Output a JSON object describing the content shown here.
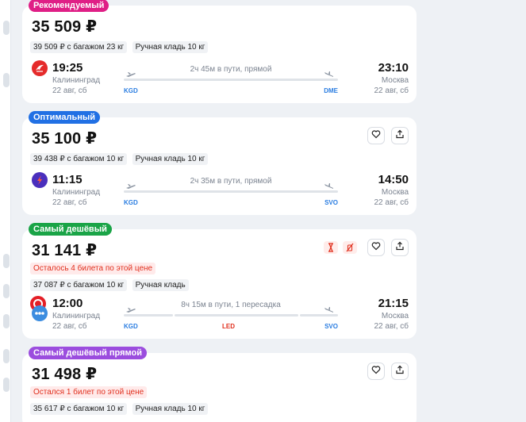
{
  "colors": {
    "recommended": "#df1f86",
    "optimal": "#2170e4",
    "cheapest": "#1aa447",
    "cheapest_direct": "#9b4dde",
    "iata_code": "#2a7de1",
    "transfer_code": "#e0301e",
    "warning_text": "#e0301e"
  },
  "icons": [
    "heart-icon",
    "share-icon",
    "plane-takeoff-icon",
    "plane-landing-icon",
    "hourglass-icon",
    "no-baggage-icon"
  ],
  "offers": [
    {
      "badge": "Рекомендуемый",
      "price": "35 509 ₽",
      "warning": "",
      "baggage_price": "39 509 ₽ с багажом 23 кг",
      "hand_luggage": "Ручная кладь 10 кг",
      "airline_logo": "red-winged-airline-logo",
      "dep_time": "19:25",
      "dep_city": "Калининград",
      "dep_date": "22 авг, сб",
      "arr_time": "23:10",
      "arr_city": "Москва",
      "arr_date": "22 авг, сб",
      "duration": "2ч 45м в пути, прямой",
      "dep_code": "KGD",
      "arr_code": "DME"
    },
    {
      "badge": "Оптимальный",
      "price": "35 100 ₽",
      "baggage_price": "39 438 ₽ с багажом 10 кг",
      "hand_luggage": "Ручная кладь 10 кг",
      "airline_logo": "purple-swoosh-airline-logo",
      "dep_time": "11:15",
      "dep_city": "Калининград",
      "dep_date": "22 авг, сб",
      "arr_time": "14:50",
      "arr_city": "Москва",
      "arr_date": "22 авг, сб",
      "duration": "2ч 35м в пути, прямой",
      "dep_code": "KGD",
      "arr_code": "SVO"
    },
    {
      "badge": "Самый дешёвый",
      "price": "31 141 ₽",
      "warning": "Осталось 4 билета по этой цене",
      "baggage_price": "37 087 ₽ с багажом 10 кг",
      "hand_luggage": "Ручная кладь",
      "dep_time": "12:00",
      "dep_city": "Калининград",
      "dep_date": "22 авг, сб",
      "arr_time": "21:15",
      "arr_city": "Москва",
      "arr_date": "22 авг, сб",
      "duration": "8ч 15м в пути, 1 пересадка",
      "dep_code": "KGD",
      "transfer_code": "LED",
      "arr_code": "SVO"
    },
    {
      "badge": "Самый дешёвый прямой",
      "price": "31 498 ₽",
      "warning": "Остался 1 билет по этой цене",
      "baggage_price": "35 617 ₽ с багажом 10 кг",
      "hand_luggage": "Ручная кладь 10 кг"
    }
  ]
}
